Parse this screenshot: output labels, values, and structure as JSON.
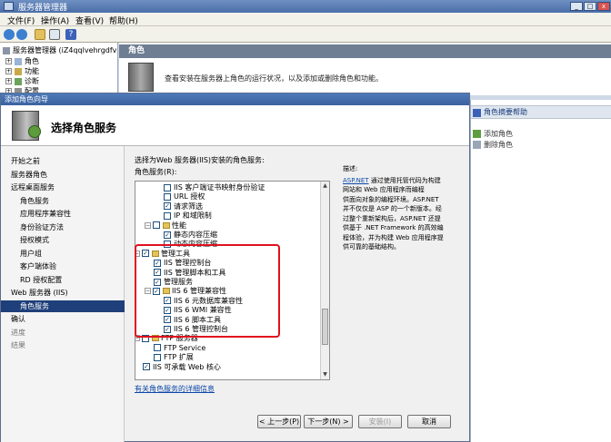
{
  "window": {
    "title": "服务器管理器"
  },
  "menu": [
    "文件(F)",
    "操作(A)",
    "查看(V)",
    "帮助(H)"
  ],
  "tree": {
    "root": "服务器管理器 (iZ4qqlvehrgdfv",
    "items": [
      "角色",
      "功能",
      "诊断",
      "配置"
    ]
  },
  "main": {
    "header": "角色",
    "summary": "查看安装在服务器上角色的运行状况，以及添加或删除角色和功能。"
  },
  "right_pane": {
    "header": "角色摘要帮助",
    "actions": [
      "添加角色",
      "删除角色"
    ]
  },
  "wizard": {
    "title": "添加角色向导",
    "heading": "选择角色服务",
    "nav": [
      {
        "label": "开始之前",
        "indent": 0,
        "state": "normal"
      },
      {
        "label": "服务器角色",
        "indent": 0,
        "state": "normal"
      },
      {
        "label": "远程桌面服务",
        "indent": 0,
        "state": "normal"
      },
      {
        "label": "角色服务",
        "indent": 1,
        "state": "normal"
      },
      {
        "label": "应用程序兼容性",
        "indent": 1,
        "state": "normal"
      },
      {
        "label": "身份验证方法",
        "indent": 1,
        "state": "normal"
      },
      {
        "label": "授权模式",
        "indent": 1,
        "state": "normal"
      },
      {
        "label": "用户组",
        "indent": 1,
        "state": "normal"
      },
      {
        "label": "客户端体验",
        "indent": 1,
        "state": "normal"
      },
      {
        "label": "RD 授权配置",
        "indent": 1,
        "state": "normal"
      },
      {
        "label": "Web 服务器 (IIS)",
        "indent": 0,
        "state": "normal"
      },
      {
        "label": "角色服务",
        "indent": 1,
        "state": "selected"
      },
      {
        "label": "确认",
        "indent": 0,
        "state": "normal"
      },
      {
        "label": "进度",
        "indent": 0,
        "state": "dim"
      },
      {
        "label": "结果",
        "indent": 0,
        "state": "dim"
      }
    ],
    "instruction": "选择为Web 服务器(IIS)安装的角色服务:",
    "list_label": "角色服务(R):",
    "services": [
      {
        "label": "IIS 客户端证书映射身份验证",
        "level": 2,
        "checked": false,
        "expander": ""
      },
      {
        "label": "URL 授权",
        "level": 2,
        "checked": false,
        "expander": ""
      },
      {
        "label": "请求筛选",
        "level": 2,
        "checked": true,
        "expander": ""
      },
      {
        "label": "IP 和域限制",
        "level": 2,
        "checked": false,
        "expander": ""
      },
      {
        "label": "性能",
        "level": 1,
        "checked": false,
        "expander": "−"
      },
      {
        "label": "静态内容压缩",
        "level": 2,
        "checked": true,
        "expander": ""
      },
      {
        "label": "动态内容压缩",
        "level": 2,
        "checked": false,
        "expander": ""
      },
      {
        "label": "管理工具",
        "level": 0,
        "checked": true,
        "expander": "−"
      },
      {
        "label": "IIS 管理控制台",
        "level": 1,
        "checked": true,
        "expander": ""
      },
      {
        "label": "IIS 管理脚本和工具",
        "level": 1,
        "checked": true,
        "expander": ""
      },
      {
        "label": "管理服务",
        "level": 1,
        "checked": true,
        "expander": ""
      },
      {
        "label": "IIS 6 管理兼容性",
        "level": 1,
        "checked": true,
        "expander": "−"
      },
      {
        "label": "IIS 6 元数据库兼容性",
        "level": 2,
        "checked": true,
        "expander": ""
      },
      {
        "label": "IIS 6 WMI 兼容性",
        "level": 2,
        "checked": true,
        "expander": ""
      },
      {
        "label": "IIS 6 脚本工具",
        "level": 2,
        "checked": true,
        "expander": ""
      },
      {
        "label": "IIS 6 管理控制台",
        "level": 2,
        "checked": true,
        "expander": ""
      },
      {
        "label": "FTP 服务器",
        "level": 0,
        "checked": false,
        "expander": "−"
      },
      {
        "label": "FTP Service",
        "level": 1,
        "checked": false,
        "expander": ""
      },
      {
        "label": "FTP 扩展",
        "level": 1,
        "checked": false,
        "expander": ""
      },
      {
        "label": "IIS 可承载 Web 核心",
        "level": 0,
        "checked": true,
        "expander": ""
      }
    ],
    "description_label": "描述:",
    "description_link": "ASP.NET",
    "description_lines": [
      "通过使用托管代码为构建",
      "网站和 Web 应用程序而编程",
      "供面向对象的编程环境。ASP.NET",
      "并不仅仅是 ASP 的一个新版本。经",
      "过整个重新架构后，ASP.NET 还提",
      "供基于 .NET Framework 的高效编",
      "程体验，并为构建 Web 应用程序提",
      "供可靠的基础结构。"
    ],
    "more_link": "有关角色服务的详细信息",
    "buttons": {
      "prev": "< 上一步(P)",
      "next": "下一步(N) >",
      "install": "安装(I)",
      "cancel": "取消"
    }
  }
}
